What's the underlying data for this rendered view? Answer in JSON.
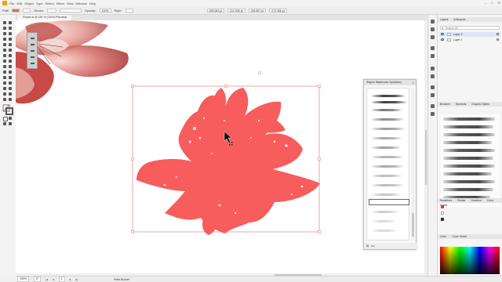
{
  "menubar": {
    "items": [
      "File",
      "Edit",
      "Object",
      "Type",
      "Select",
      "Effect",
      "View",
      "Window",
      "Help"
    ]
  },
  "controlbar": {
    "selection_label": "Path",
    "stroke_label": "Stroke:",
    "opacity_label": "Opacity:",
    "opacity_value": "100%",
    "style_label": "Style:",
    "x_value": "289.083 pt",
    "y_value": "212.536 pt",
    "w_value": "305.807 pt",
    "h_value": "272.366 pt"
  },
  "document_tab": {
    "title": "Flower.ai @ 150 % (CMYK/Preview)"
  },
  "statusbar": {
    "zoom": "150%",
    "angle": "0°",
    "artboard": "1",
    "tool_name": "Paint Bucket"
  },
  "layers_panel": {
    "tabs": [
      "Layers",
      "Artboards"
    ],
    "search_placeholder": "Search All",
    "layers": [
      {
        "name": "Layer 2"
      },
      {
        "name": "Layer 1"
      }
    ]
  },
  "brushes_panel": {
    "tabs": [
      "Brushes",
      "Symbols",
      "Graphic Styles"
    ]
  },
  "lower_panels": {
    "tabs": [
      "Swatches",
      "Stroke",
      "Gradient",
      "Color Guide"
    ],
    "color_tabs": [
      "Color",
      "Color Guide"
    ]
  },
  "floating_panel": {
    "title": "Seguin Watercolor Splotches"
  },
  "colors": {
    "flower_fill": "#f65d5c",
    "bbox": "#e86a6a",
    "accent": "#ff9a00"
  }
}
